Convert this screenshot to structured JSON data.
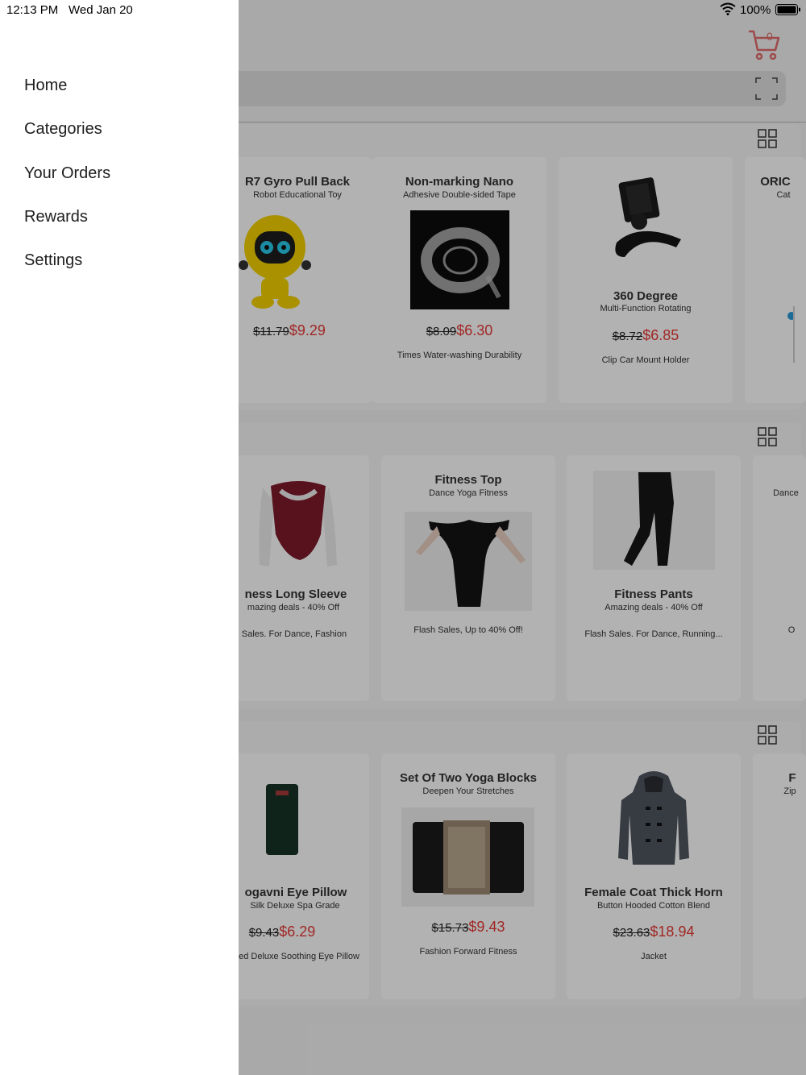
{
  "status_bar": {
    "time": "12:13 PM",
    "date": "Wed Jan 20",
    "battery": "100%"
  },
  "header": {
    "cart_count": "0"
  },
  "drawer": {
    "items": [
      {
        "label": "Home"
      },
      {
        "label": "Categories"
      },
      {
        "label": "Your Orders"
      },
      {
        "label": "Rewards"
      },
      {
        "label": "Settings"
      }
    ]
  },
  "sections": [
    {
      "cards": [
        {
          "title": "R7 Gyro Pull Back",
          "subtitle": "Robot Educational Toy",
          "old_price": "$11.79",
          "new_price": "$9.29",
          "desc": ""
        },
        {
          "title": "Non-marking Nano",
          "subtitle": "Adhesive Double-sided Tape",
          "old_price": "$8.09",
          "new_price": "$6.30",
          "desc": "Times Water-washing Durability"
        },
        {
          "title": "360 Degree",
          "subtitle": "Multi-Function Rotating",
          "old_price": "$8.72",
          "new_price": "$6.85",
          "desc": "Clip Car Mount Holder"
        },
        {
          "title": "ORIC",
          "subtitle": "Cat",
          "old_price": "",
          "new_price": "",
          "desc": ""
        }
      ]
    },
    {
      "cards": [
        {
          "title": "ness Long Sleeve",
          "subtitle": "mazing deals - 40% Off",
          "desc": "Sales. For Dance, Fashion"
        },
        {
          "title": "Fitness Top",
          "subtitle": "Dance Yoga Fitness",
          "desc": "Flash Sales, Up to 40% Off!"
        },
        {
          "title": "Fitness Pants",
          "subtitle": "Amazing deals - 40% Off",
          "desc": "Flash Sales. For Dance, Running..."
        },
        {
          "title": "",
          "subtitle": "Dance",
          "desc": "O"
        }
      ]
    },
    {
      "cards": [
        {
          "title": "ogavni Eye Pillow",
          "subtitle": "Silk Deluxe Spa Grade",
          "old_price": "$9.43",
          "new_price": "$6.29",
          "desc": "ed Deluxe Soothing Eye Pillow"
        },
        {
          "title": "Set Of Two Yoga Blocks",
          "subtitle": "Deepen Your Stretches",
          "old_price": "$15.73",
          "new_price": "$9.43",
          "desc": "Fashion Forward Fitness"
        },
        {
          "title": "Female Coat Thick Horn",
          "subtitle": "Button Hooded Cotton Blend",
          "old_price": "$23.63",
          "new_price": "$18.94",
          "desc": "Jacket"
        },
        {
          "title": "F",
          "subtitle": "Zip",
          "old_price": "",
          "new_price": "",
          "desc": ""
        }
      ]
    }
  ],
  "colors": {
    "accent": "#e53935",
    "scrim": "rgba(0,0,0,0.30)",
    "drawer": "#ffffff"
  },
  "icons": [
    "cart-icon",
    "scan-icon",
    "grid-view-icon",
    "wifi-icon",
    "battery-icon"
  ]
}
